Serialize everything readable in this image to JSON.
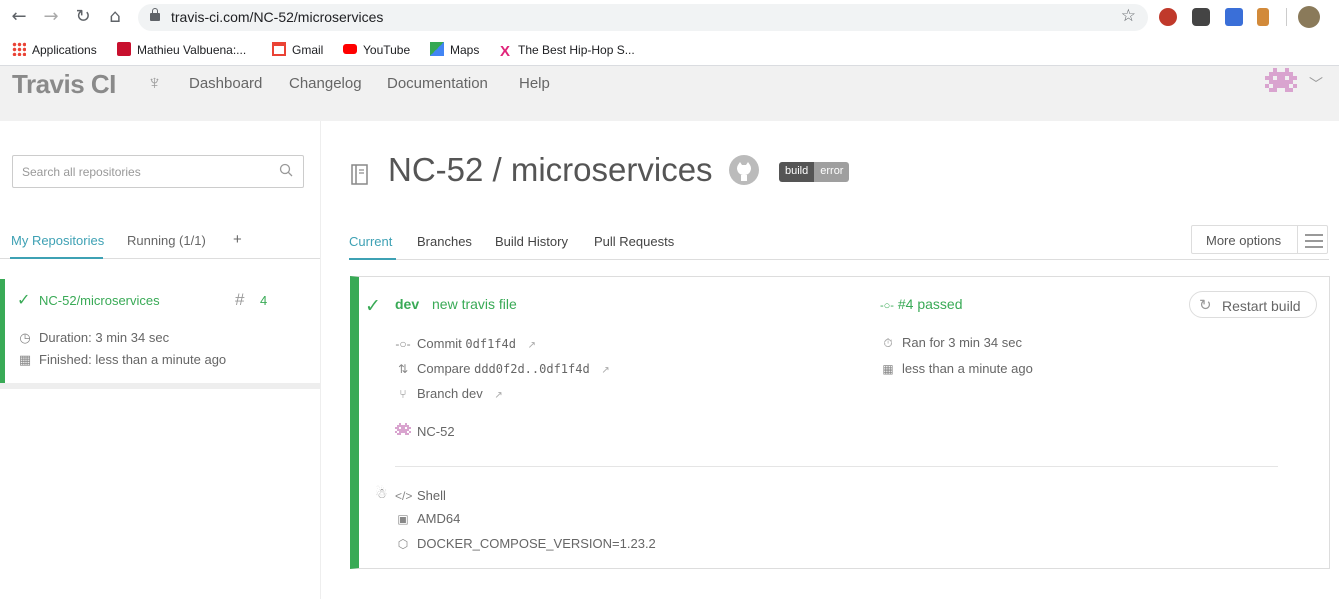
{
  "browser": {
    "url": "travis-ci.com/NC-52/microservices",
    "bookmarks": [
      {
        "label": "Applications"
      },
      {
        "label": "Mathieu Valbuena:..."
      },
      {
        "label": "Gmail"
      },
      {
        "label": "YouTube"
      },
      {
        "label": "Maps"
      },
      {
        "label": "The Best Hip-Hop S..."
      }
    ]
  },
  "header": {
    "logo": "Travis CI",
    "nav": [
      "Dashboard",
      "Changelog",
      "Documentation",
      "Help"
    ]
  },
  "sidebar": {
    "search_placeholder": "Search all repositories",
    "tabs": [
      "My Repositories",
      "Running (1/1)",
      "+"
    ],
    "repo": {
      "name": "NC-52/microservices",
      "build_number": "4",
      "duration": "Duration: 3 min 34 sec",
      "finished": "Finished: less than a minute ago"
    }
  },
  "main": {
    "title": "NC-52 / microservices",
    "badge": {
      "left": "build",
      "right": "error"
    },
    "tabs": [
      "Current",
      "Branches",
      "Build History",
      "Pull Requests"
    ],
    "more_options": "More options",
    "build": {
      "branch": "dev",
      "message": "new travis file",
      "status": "#4 passed",
      "commit_label": "Commit",
      "commit_hash": "0df1f4d",
      "compare_label": "Compare",
      "compare_range": "ddd0f2d..0df1f4d",
      "branch_label": "Branch dev",
      "author": "NC-52",
      "ran_for": "Ran for 3 min 34 sec",
      "finished": "less than a minute ago",
      "restart": "Restart build",
      "language": "Shell",
      "arch": "AMD64",
      "env": "DOCKER_COMPOSE_VERSION=1.23.2"
    }
  },
  "colors": {
    "passed": "#39aa56",
    "accent": "#3ea1b4"
  }
}
